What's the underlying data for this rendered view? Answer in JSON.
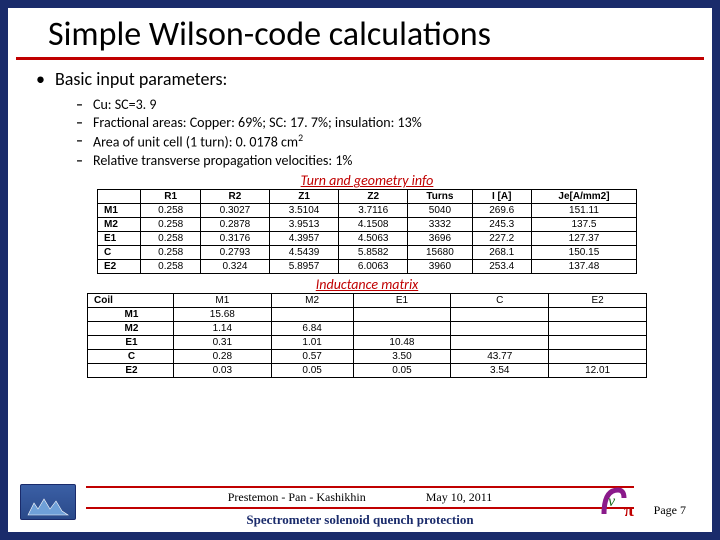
{
  "title": "Simple Wilson-code calculations",
  "heading": "Basic input parameters:",
  "subitems": [
    "Cu: SC=3. 9",
    "Fractional areas: Copper: 69%; SC: 17. 7%; insulation: 13%",
    "Area of unit cell (1 turn): 0. 0178 cm",
    "Relative transverse propagation velocities: 1%"
  ],
  "unit_super": "2",
  "caption1": "Turn and geometry info",
  "table1": {
    "headers": [
      "",
      "R1",
      "R2",
      "Z1",
      "Z2",
      "Turns",
      "I [A]",
      "Je[A/mm2]"
    ],
    "rows": [
      [
        "M1",
        "0.258",
        "0.3027",
        "3.5104",
        "3.7116",
        "5040",
        "269.6",
        "151.11"
      ],
      [
        "M2",
        "0.258",
        "0.2878",
        "3.9513",
        "4.1508",
        "3332",
        "245.3",
        "137.5"
      ],
      [
        "E1",
        "0.258",
        "0.3176",
        "4.3957",
        "4.5063",
        "3696",
        "227.2",
        "127.37"
      ],
      [
        "C",
        "0.258",
        "0.2793",
        "4.5439",
        "5.8582",
        "15680",
        "268.1",
        "150.15"
      ],
      [
        "E2",
        "0.258",
        "0.324",
        "5.8957",
        "6.0063",
        "3960",
        "253.4",
        "137.48"
      ]
    ]
  },
  "caption2": "Inductance matrix",
  "table2": {
    "headers": [
      "Coil",
      "M1",
      "M2",
      "E1",
      "C",
      "E2"
    ],
    "rows": [
      [
        "M1",
        "15.68",
        "",
        "",
        "",
        ""
      ],
      [
        "M2",
        "1.14",
        "6.84",
        "",
        "",
        ""
      ],
      [
        "E1",
        "0.31",
        "1.01",
        "10.48",
        "",
        ""
      ],
      [
        "C",
        "0.28",
        "0.57",
        "3.50",
        "43.77",
        ""
      ],
      [
        "E2",
        "0.03",
        "0.05",
        "0.05",
        "3.54",
        "12.01"
      ]
    ]
  },
  "footer": {
    "authors": "Prestemon - Pan - Kashikhin",
    "date": "May 10, 2011",
    "doc_title": "Spectrometer solenoid quench protection",
    "page": "Page 7"
  }
}
